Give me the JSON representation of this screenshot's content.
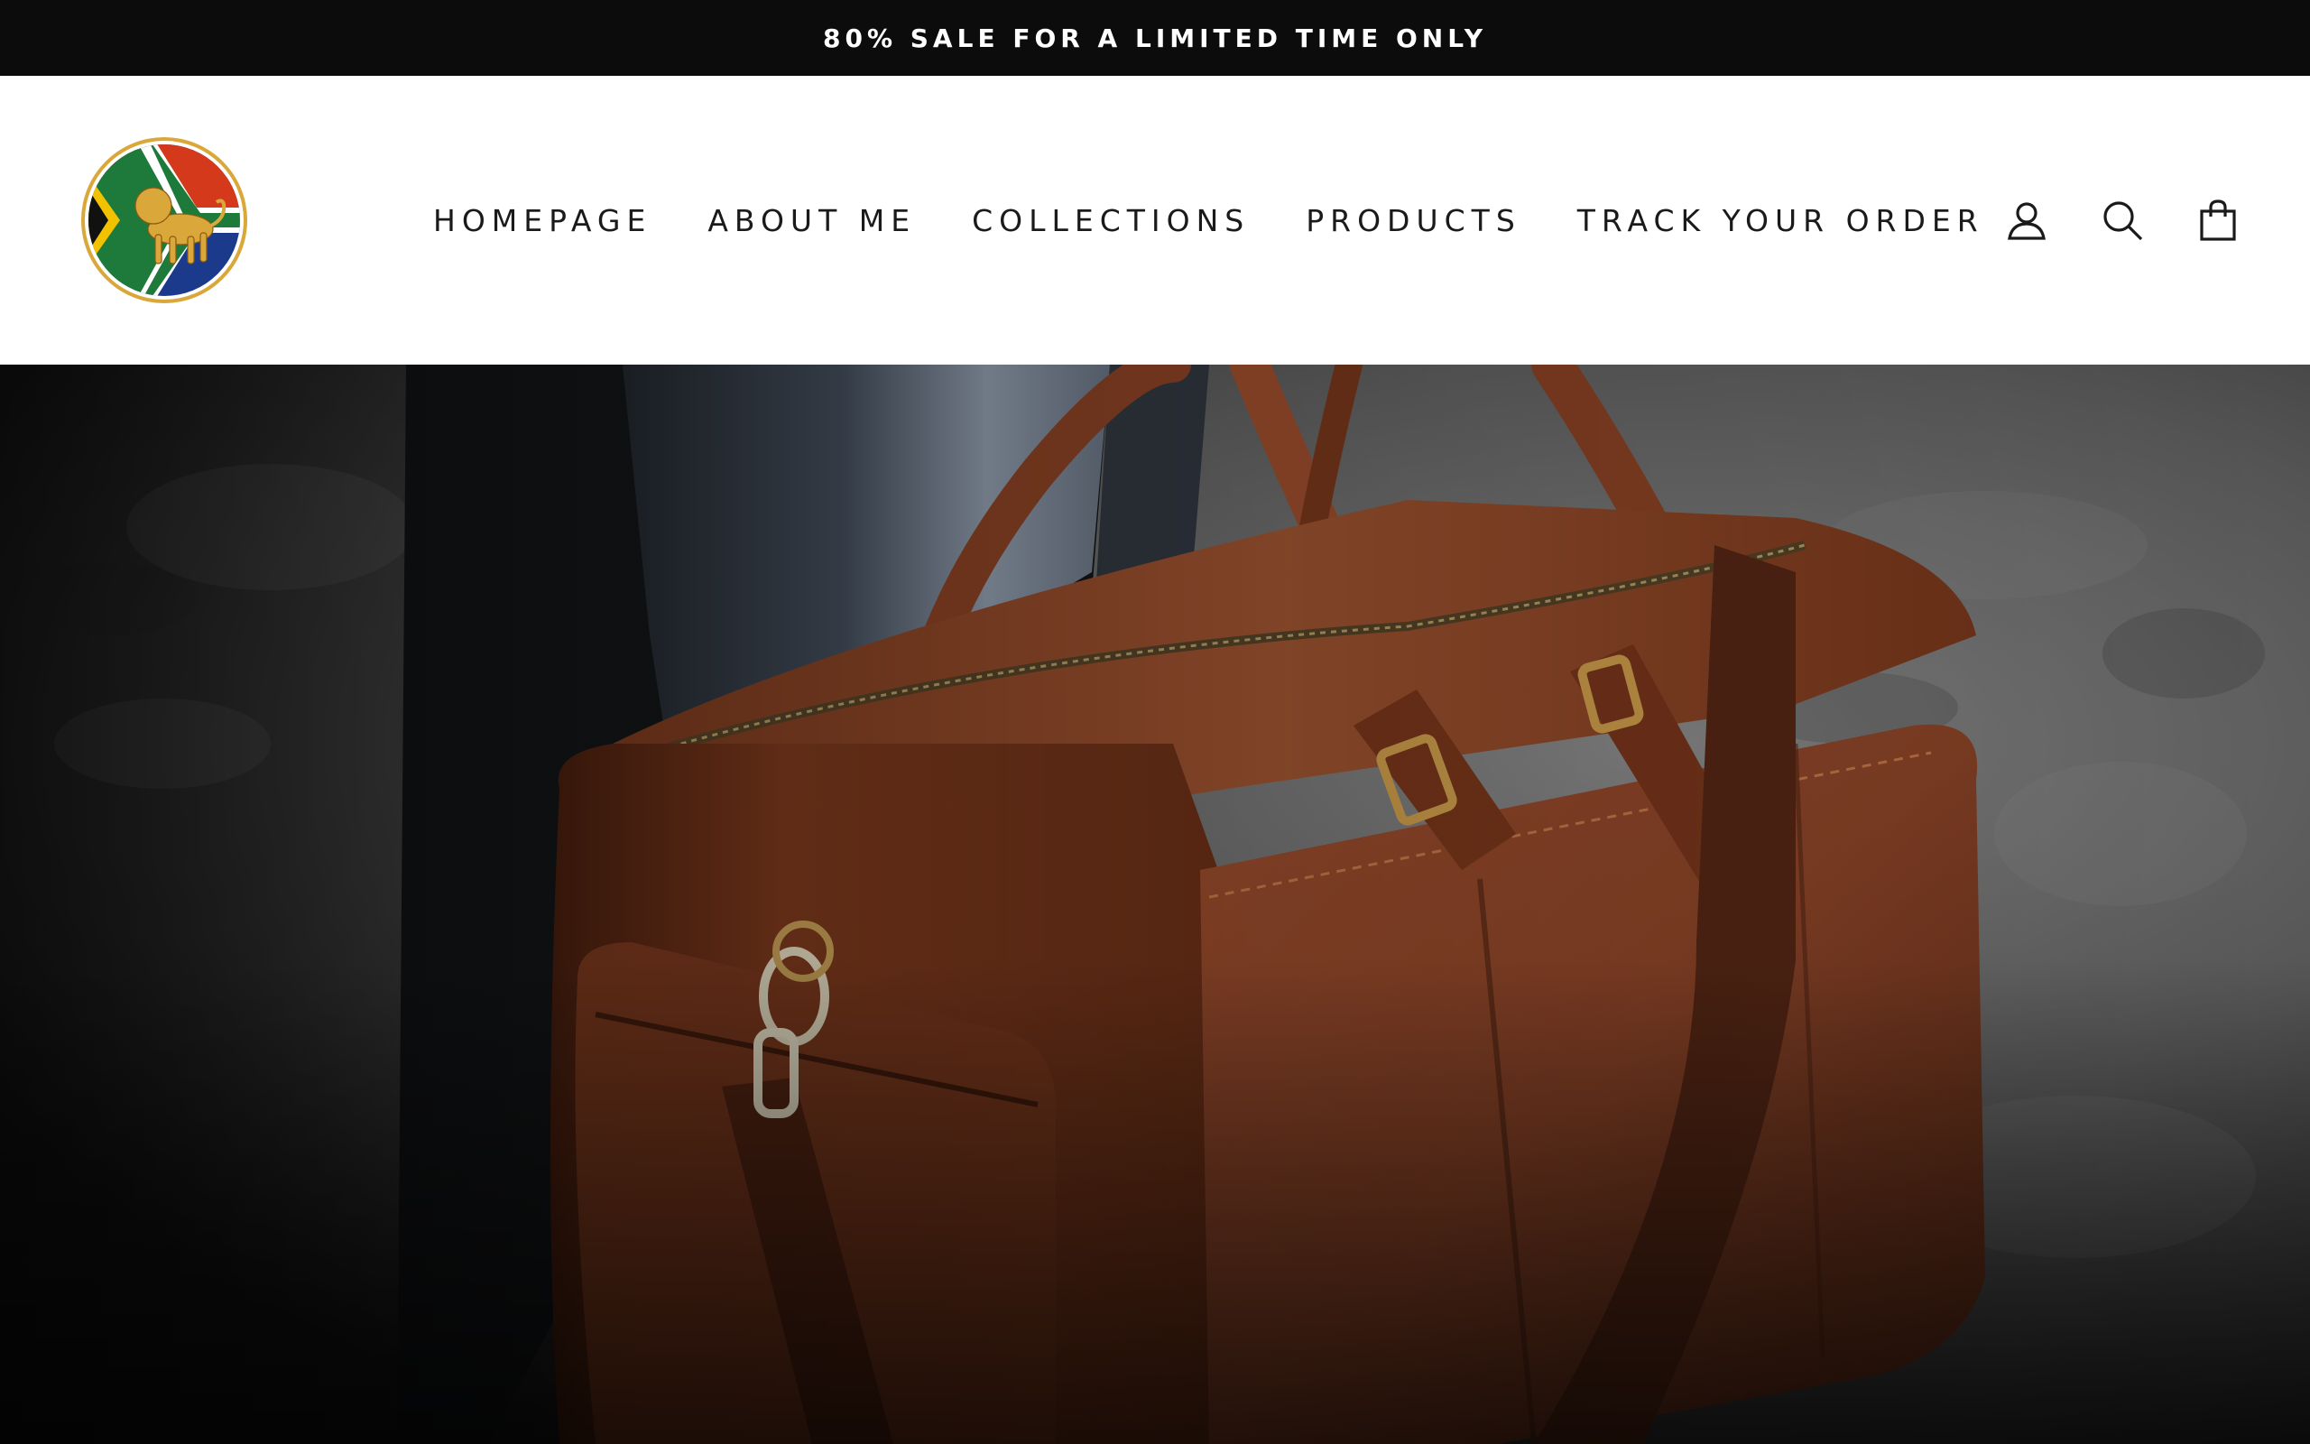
{
  "announcement": {
    "text": "80% SALE FOR A LIMITED TIME ONLY"
  },
  "nav": {
    "items": [
      {
        "label": "HOMEPAGE"
      },
      {
        "label": "ABOUT ME"
      },
      {
        "label": "COLLECTIONS"
      },
      {
        "label": "PRODUCTS"
      },
      {
        "label": "TRACK YOUR ORDER"
      }
    ]
  },
  "icons": {
    "account": "user-icon",
    "search": "search-icon",
    "cart": "shopping-bag-icon"
  },
  "colors": {
    "announcement_bg": "#0c0c0c",
    "leather": "#7a3b22",
    "flag_red": "#d4391b",
    "flag_blue": "#1b3a8c",
    "flag_green": "#1e7a3a",
    "logo_gold": "#d9a73a"
  }
}
